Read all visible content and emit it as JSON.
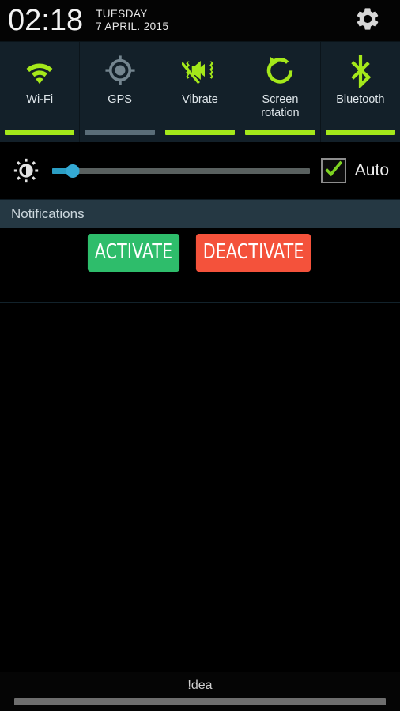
{
  "header": {
    "clock": "02:18",
    "day": "TUESDAY",
    "date": "7 APRIL. 2015",
    "settings_icon": "gear-icon"
  },
  "quick_settings": {
    "toggles": [
      {
        "label": "Wi-Fi",
        "icon": "wifi-icon",
        "active": true
      },
      {
        "label": "GPS",
        "icon": "gps-crosshair-icon",
        "active": false
      },
      {
        "label": "Vibrate",
        "icon": "vibrate-muted-speaker-icon",
        "active": true
      },
      {
        "label": "Screen\nrotation",
        "icon": "screen-rotation-icon",
        "active": true
      },
      {
        "label": "Bluetooth",
        "icon": "bluetooth-icon",
        "active": true
      }
    ],
    "active_color": "#a4e81a",
    "inactive_color": "#5a6d78",
    "panel_color": "#132029"
  },
  "brightness": {
    "icon": "brightness-sun-icon",
    "value_percent": 8,
    "fill_color": "#2b9ec4",
    "thumb_color": "#34a9d4",
    "track_color": "#59605f",
    "auto_label": "Auto",
    "auto_checked": true,
    "check_color": "#7ed321"
  },
  "notifications": {
    "title": "Notifications",
    "buttons": [
      {
        "label": "ACTIVATE",
        "color": "#2ebd6b"
      },
      {
        "label": "DEACTIVATE",
        "color": "#f4523b"
      }
    ]
  },
  "bottom": {
    "carrier": "!dea",
    "handle": "drag-handle"
  }
}
